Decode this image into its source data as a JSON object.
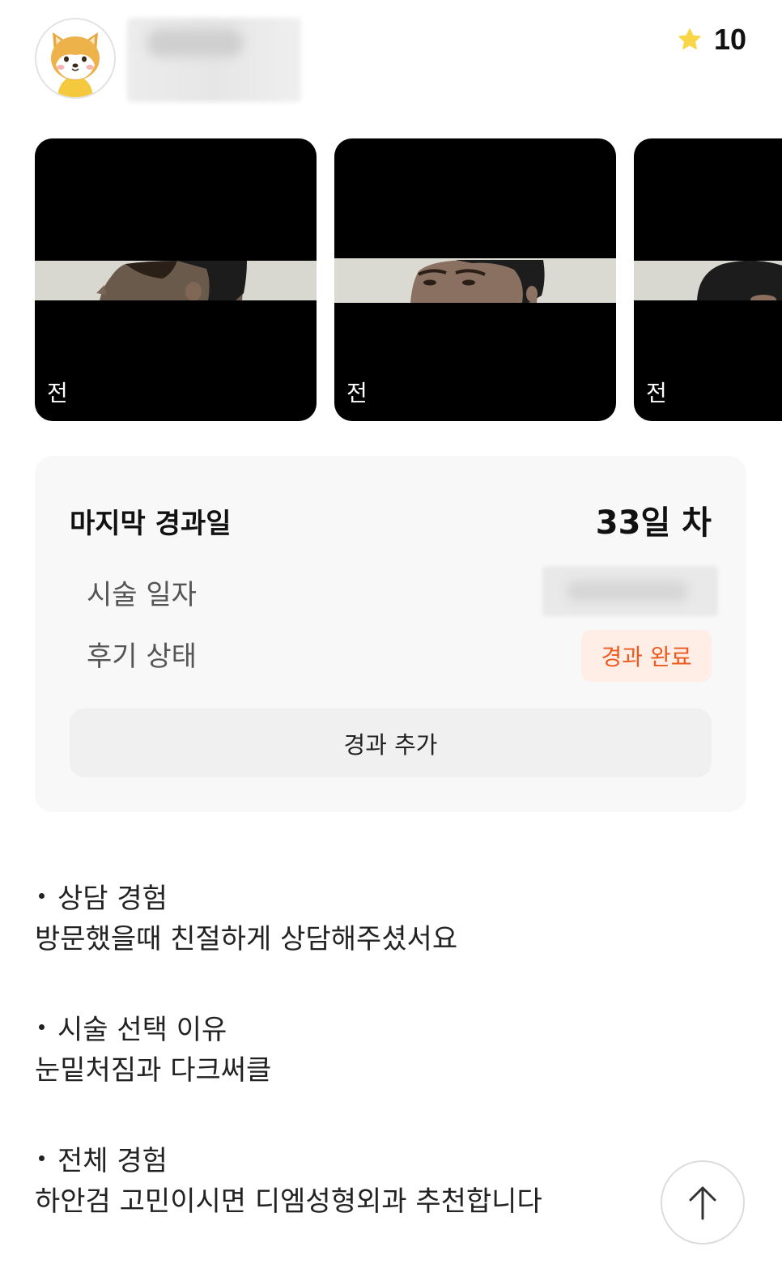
{
  "header": {
    "avatar_icon": "shiba-dog-avatar-icon",
    "rating_icon": "star-icon",
    "rating_color": "#f9d648",
    "rating_value": "10"
  },
  "photos": [
    {
      "label": "전"
    },
    {
      "label": "전"
    },
    {
      "label": "전"
    }
  ],
  "info": {
    "last_progress_label": "마지막 경과일",
    "last_progress_value": "33일 차",
    "procedure_date_label": "시술 일자",
    "review_status_label": "후기 상태",
    "review_status_value": "경과 완료",
    "status_color": "#ee5a1e",
    "add_progress_label": "경과 추가"
  },
  "review": {
    "sections": [
      {
        "heading": "상담 경험",
        "body": "방문했을때 친절하게 상담해주셨서요"
      },
      {
        "heading": "시술 선택 이유",
        "body": "눈밑처짐과 다크써클"
      },
      {
        "heading": "전체 경험",
        "body": "하안검 고민이시면 디엠성형외과 추천합니다"
      }
    ]
  },
  "scroll_top_icon": "arrow-up-icon"
}
